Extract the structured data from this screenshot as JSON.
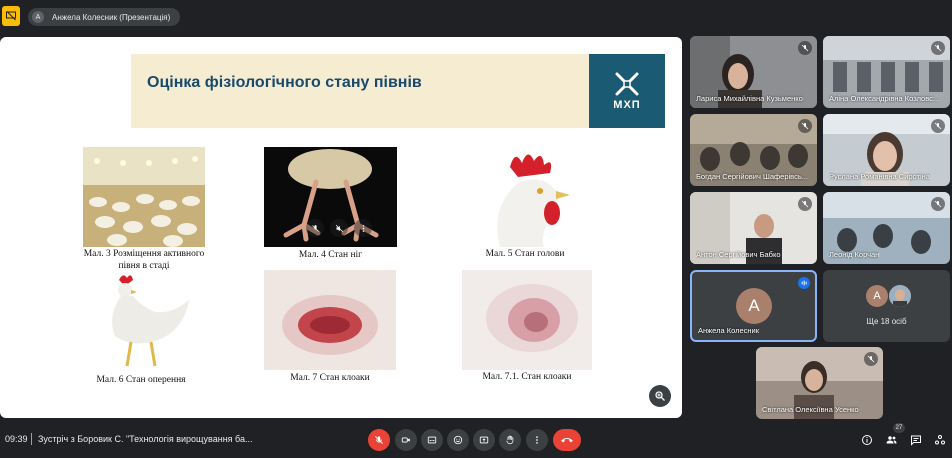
{
  "top_bar": {
    "presenter_initial": "А",
    "presenter_label": "Анжела Колесник (Презентація)"
  },
  "slide": {
    "title": "Оцінка фізіологічного стану півнів",
    "logo_text": "МХП",
    "captions": {
      "pic3": "Мал. 3 Розміщення активного півня в стаді",
      "pic4": "Мал. 4 Стан ніг",
      "pic5": "Мал. 5 Стан голови",
      "pic6": "Мал. 6 Стан оперення",
      "pic7": "Мал. 7 Стан клоаки",
      "pic71": "Мал. 7.1. Стан клоаки"
    }
  },
  "participants": [
    {
      "name": "Лариса Михайлівна Кузьменко"
    },
    {
      "name": "Аліна Олександрівна Козловс..."
    },
    {
      "name": "Богдан Сергійович Шаферівсь..."
    },
    {
      "name": "Руслана Романівна Сиротіна"
    },
    {
      "name": "Антон Сергійович Бабко"
    },
    {
      "name": "Леонід Корчан"
    },
    {
      "name": "Анжела Колесник",
      "initial": "А"
    },
    {
      "name": "Світлана Олексіївна Усенко"
    }
  ],
  "others_tile": {
    "initial": "А",
    "label": "Ще 18 осіб"
  },
  "bottom_bar": {
    "time": "09:39",
    "meeting_title": "Зустріч з Боровик С. \"Технологія вирощування ба...",
    "participant_count": "27"
  },
  "colors": {
    "background": "#202124",
    "end_call": "#ea4335",
    "slide_title": "#1a4a6b",
    "logo_bg": "#1b5a73",
    "banner_bg": "#f5ecd2",
    "speaking_border": "#8ab4f8",
    "avatar_bg": "#a9806c"
  }
}
